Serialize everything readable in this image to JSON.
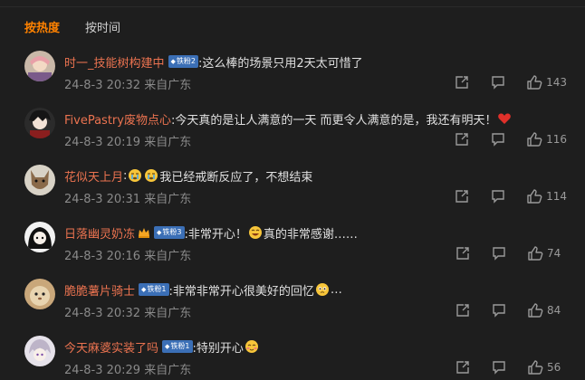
{
  "tabs": [
    {
      "label": "按热度",
      "active": true
    },
    {
      "label": "按时间",
      "active": false
    }
  ],
  "comments": [
    {
      "name": "时一_技能树构建中",
      "badge": "铁粉2",
      "text": ":这么棒的场景只用2天太可惜了",
      "time": "24-8-3 20:32 来自广东",
      "likes": "143"
    },
    {
      "name": "FivePastry废物点心",
      "badge": "",
      "text": ":今天真的是让人满意的一天 而更令人满意的是，我还有明天！",
      "emoji_after": "heart",
      "time": "24-8-3 20:19 来自广东",
      "likes": "116"
    },
    {
      "name": "花似天上月",
      "badge": "",
      "text_pre": ":",
      "text": "我已经戒断反应了，不想结束",
      "emoji_before": "cry",
      "time": "24-8-3 20:31 来自广东",
      "likes": "114"
    },
    {
      "name": "日落幽灵奶冻",
      "badge": "铁粉3",
      "text": ":非常开心！",
      "text2": "真的非常感谢……",
      "time": "24-8-3 20:16 来自广东",
      "likes": "74"
    },
    {
      "name": "脆脆薯片骑士",
      "badge": "铁粉1",
      "text": ":非常非常开心很美好的回忆",
      "text2": "…",
      "time": "24-8-3 20:32 来自广东",
      "likes": "84"
    },
    {
      "name": "今天麻婆实装了吗",
      "badge": "铁粉1",
      "text": ":特别开心",
      "time": "24-8-3 20:29 来自广东",
      "likes": "56"
    }
  ],
  "icons": {
    "share": "share-icon",
    "reply": "comment-icon",
    "like": "thumbs-up-icon"
  },
  "colors": {
    "accent": "#ff8200",
    "username": "#eb7350",
    "badge": "#3b6fb6",
    "background": "#1e1e1e"
  }
}
